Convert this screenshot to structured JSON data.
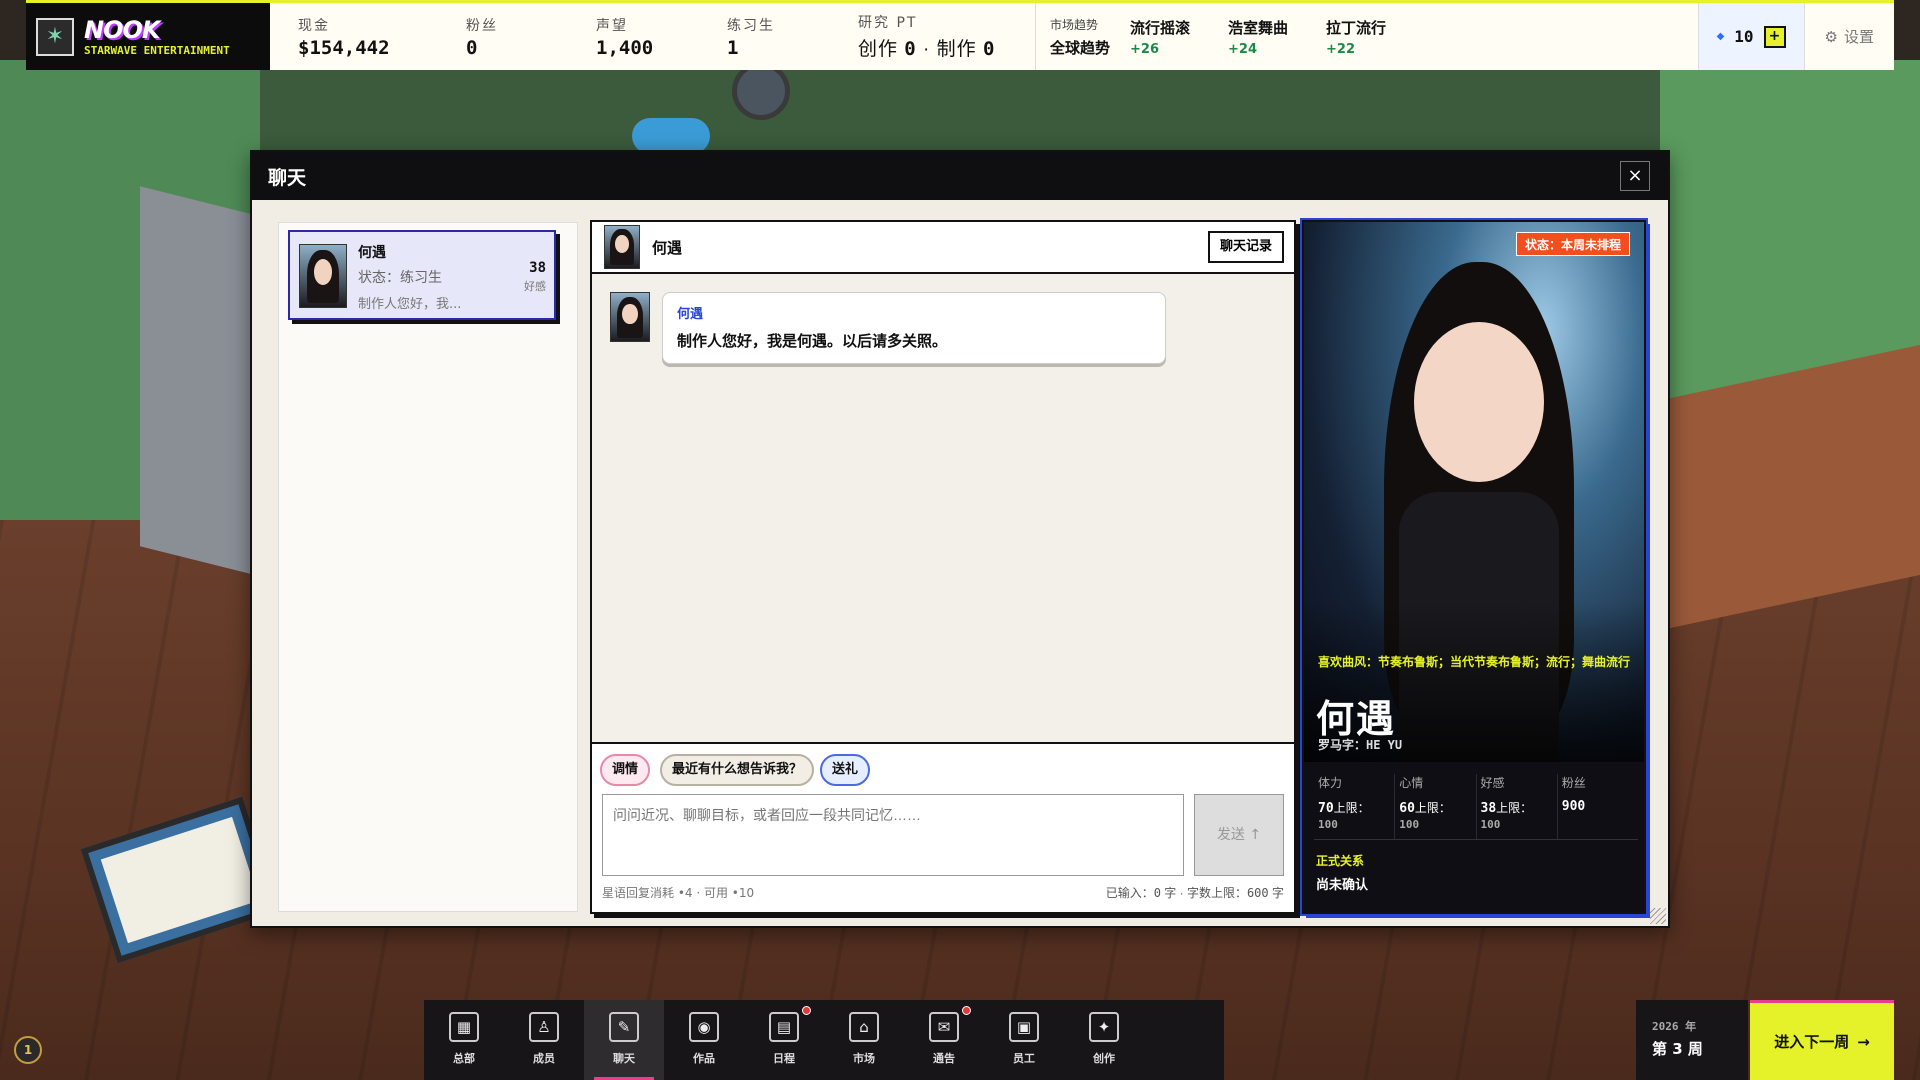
{
  "hud": {
    "brand": "NOOK",
    "brand_sub": "STARWAVE ENTERTAINMENT",
    "cash_label": "现金",
    "cash_value": "$154,442",
    "fans_label": "粉丝",
    "fans_value": "0",
    "reputation_label": "声望",
    "reputation_value": "1,400",
    "trainee_label": "练习生",
    "trainee_value": "1",
    "research_label": "研究 PT",
    "research_create_label": "创作",
    "research_create_value": "0",
    "research_produce_label": "制作",
    "research_produce_value": "0",
    "trends_label": "市场趋势",
    "trends_scope": "全球趋势",
    "trends": [
      {
        "name": "流行摇滚",
        "delta": "+26"
      },
      {
        "name": "浩室舞曲",
        "delta": "+24"
      },
      {
        "name": "拉丁流行",
        "delta": "+22"
      }
    ],
    "credits_value": "10",
    "plus_label": "+",
    "settings_label": "设置"
  },
  "modal": {
    "title": "聊天",
    "close_label": "×"
  },
  "contact": {
    "name": "何遇",
    "status": "状态：练习生",
    "preview": "制作人您好，我...",
    "affection_value": "38",
    "affection_label": "好感"
  },
  "chat": {
    "partner_name": "何遇",
    "history_button": "聊天记录",
    "messages": [
      {
        "sender": "何遇",
        "text": "制作人您好，我是何遇。以后请多关照。"
      }
    ],
    "quick_replies": [
      "调情",
      "最近有什么想告诉我？",
      "送礼"
    ],
    "input_placeholder": "问问近况、聊聊目标，或者回应一段共同记忆……",
    "send_label": "发送 ↑",
    "cost_note": "星语回复消耗 •4 · 可用 •10",
    "count_prefix": "已输入：",
    "count_value": "0",
    "count_unit": "字 · 字数上限：",
    "limit_value": "600",
    "limit_unit": "字"
  },
  "profile": {
    "rank_badge": "状态：本周未排程",
    "genres": "喜欢曲风：节奏布鲁斯；当代节奏布鲁斯；流行；舞曲流行",
    "name": "何遇",
    "romaji": "罗马字：HE YU",
    "stats": [
      {
        "label": "体力",
        "value": "70",
        "suffix": "上限：",
        "max": "100"
      },
      {
        "label": "心情",
        "value": "60",
        "suffix": "上限：",
        "max": "100"
      },
      {
        "label": "好感",
        "value": "38",
        "suffix": "上限：",
        "max": "100"
      },
      {
        "label": "粉丝",
        "value": "900",
        "suffix": "",
        "max": ""
      }
    ],
    "relation_label": "正式关系",
    "relation_value": "尚未确认"
  },
  "nav": {
    "items": [
      {
        "label": "总部",
        "icon": "building-icon",
        "glyph": "▦"
      },
      {
        "label": "成员",
        "icon": "person-icon",
        "glyph": "♙"
      },
      {
        "label": "聊天",
        "icon": "chat-icon",
        "glyph": "✎"
      },
      {
        "label": "作品",
        "icon": "disc-icon",
        "glyph": "◉"
      },
      {
        "label": "日程",
        "icon": "calendar-icon",
        "glyph": "▤"
      },
      {
        "label": "市场",
        "icon": "market-icon",
        "glyph": "⌂"
      },
      {
        "label": "通告",
        "icon": "notice-icon",
        "glyph": "✉"
      },
      {
        "label": "员工",
        "icon": "briefcase-icon",
        "glyph": "▣"
      },
      {
        "label": "创作",
        "icon": "compose-icon",
        "glyph": "✦"
      }
    ]
  },
  "date": {
    "year": "2026 年",
    "week": "第 3 周"
  },
  "next_week_label": "进入下一周",
  "next_week_arrow": "→",
  "corner_badge": "1"
}
